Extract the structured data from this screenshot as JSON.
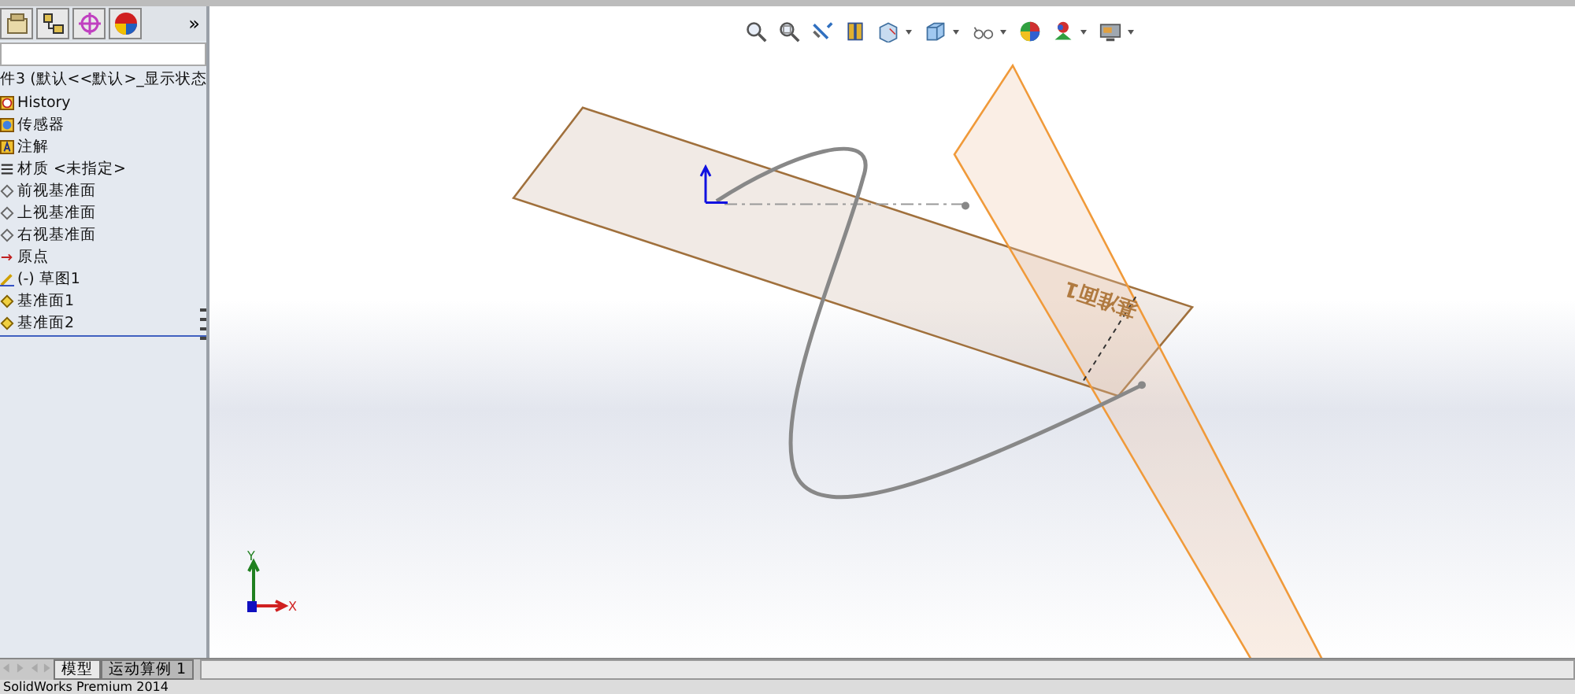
{
  "panel_tabs": [
    {
      "kind": "tree"
    },
    {
      "kind": "property"
    },
    {
      "kind": "config"
    },
    {
      "kind": "display"
    }
  ],
  "panel_more": "»",
  "tree": {
    "root": "件3 (默认<<默认>_显示状态",
    "items": [
      {
        "kind": "history",
        "label": "History"
      },
      {
        "kind": "sensor",
        "label": "传感器"
      },
      {
        "kind": "annotation",
        "label": "注解"
      },
      {
        "kind": "material",
        "label": "材质 <未指定>"
      },
      {
        "kind": "plane",
        "label": "前视基准面"
      },
      {
        "kind": "plane",
        "label": "上视基准面"
      },
      {
        "kind": "plane",
        "label": "右视基准面"
      },
      {
        "kind": "origin",
        "label": "原点"
      },
      {
        "kind": "sketch",
        "label": "(-) 草图1"
      },
      {
        "kind": "ref-plane",
        "label": "基准面1"
      },
      {
        "kind": "ref-plane",
        "label": "基准面2"
      }
    ]
  },
  "toolbar": [
    {
      "kind": "zoom-fit",
      "dropdown": false
    },
    {
      "kind": "zoom-area",
      "dropdown": false
    },
    {
      "kind": "previous",
      "dropdown": false
    },
    {
      "kind": "section",
      "dropdown": false
    },
    {
      "kind": "orientation",
      "dropdown": true
    },
    {
      "kind": "cube",
      "dropdown": true
    },
    {
      "kind": "glasses",
      "dropdown": true
    },
    {
      "kind": "appearance",
      "dropdown": false
    },
    {
      "kind": "scene",
      "dropdown": true
    },
    {
      "kind": "monitor",
      "dropdown": true
    }
  ],
  "viewport": {
    "plane_label": "基准面1",
    "triad": {
      "y": "Y",
      "x": "X"
    }
  },
  "bottom_tabs": [
    {
      "label": "模型",
      "selected": true
    },
    {
      "label": "运动算例 1",
      "selected": false
    }
  ],
  "status_bar": "SolidWorks Premium 2014"
}
